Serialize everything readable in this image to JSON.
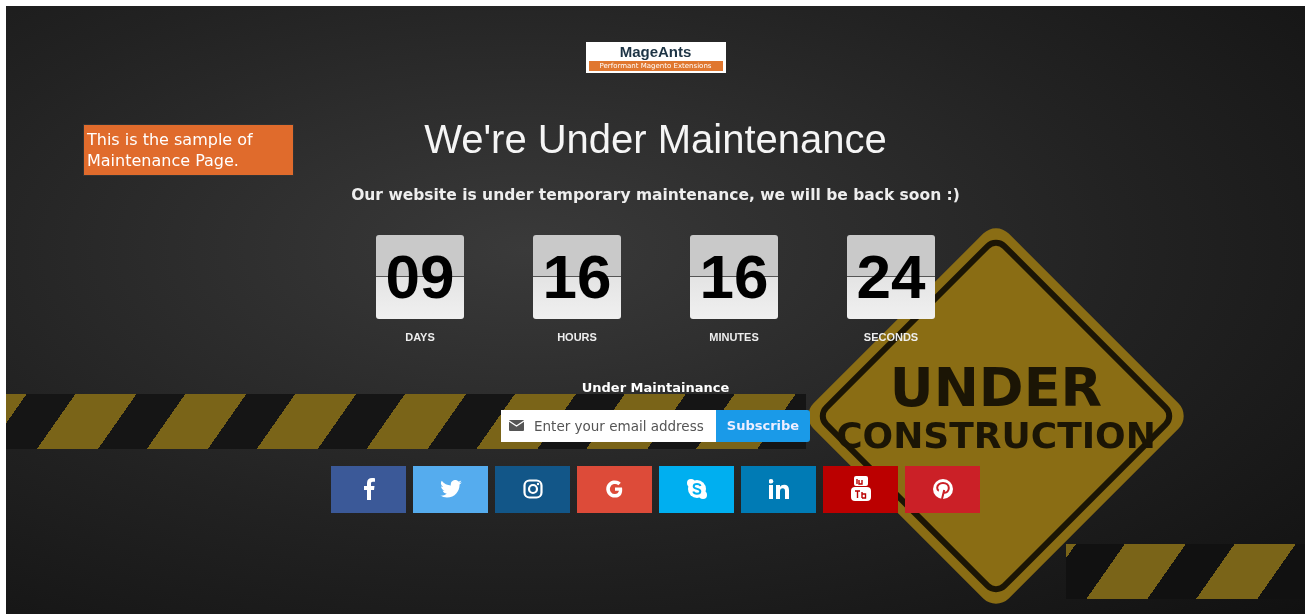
{
  "logo": {
    "name": "MageAnts",
    "tagline": "Performant Magento Extensions"
  },
  "note": "This is the sample of Maintenance Page.",
  "title": "We're Under Maintenance",
  "subtitle": "Our website is under temporary maintenance, we will be back soon :)",
  "countdown": [
    {
      "value": "09",
      "label": "DAYS"
    },
    {
      "value": "16",
      "label": "HOURS"
    },
    {
      "value": "16",
      "label": "MINUTES"
    },
    {
      "value": "24",
      "label": "SECONDS"
    }
  ],
  "newsletter": {
    "heading": "Under Maintainance",
    "placeholder": "Enter your email address",
    "button": "Subscribe"
  },
  "social": [
    {
      "kind": "facebook",
      "color": "#3b5998"
    },
    {
      "kind": "twitter",
      "color": "#55acee"
    },
    {
      "kind": "instagram",
      "color": "#125688"
    },
    {
      "kind": "google",
      "color": "#dd4b39"
    },
    {
      "kind": "skype",
      "color": "#00aff0"
    },
    {
      "kind": "linkedin",
      "color": "#007bb5"
    },
    {
      "kind": "youtube",
      "color": "#bb0000"
    },
    {
      "kind": "pinterest",
      "color": "#cb2027"
    }
  ],
  "sign": {
    "lines": [
      "UNDER",
      "CONSTRUCTION"
    ]
  }
}
